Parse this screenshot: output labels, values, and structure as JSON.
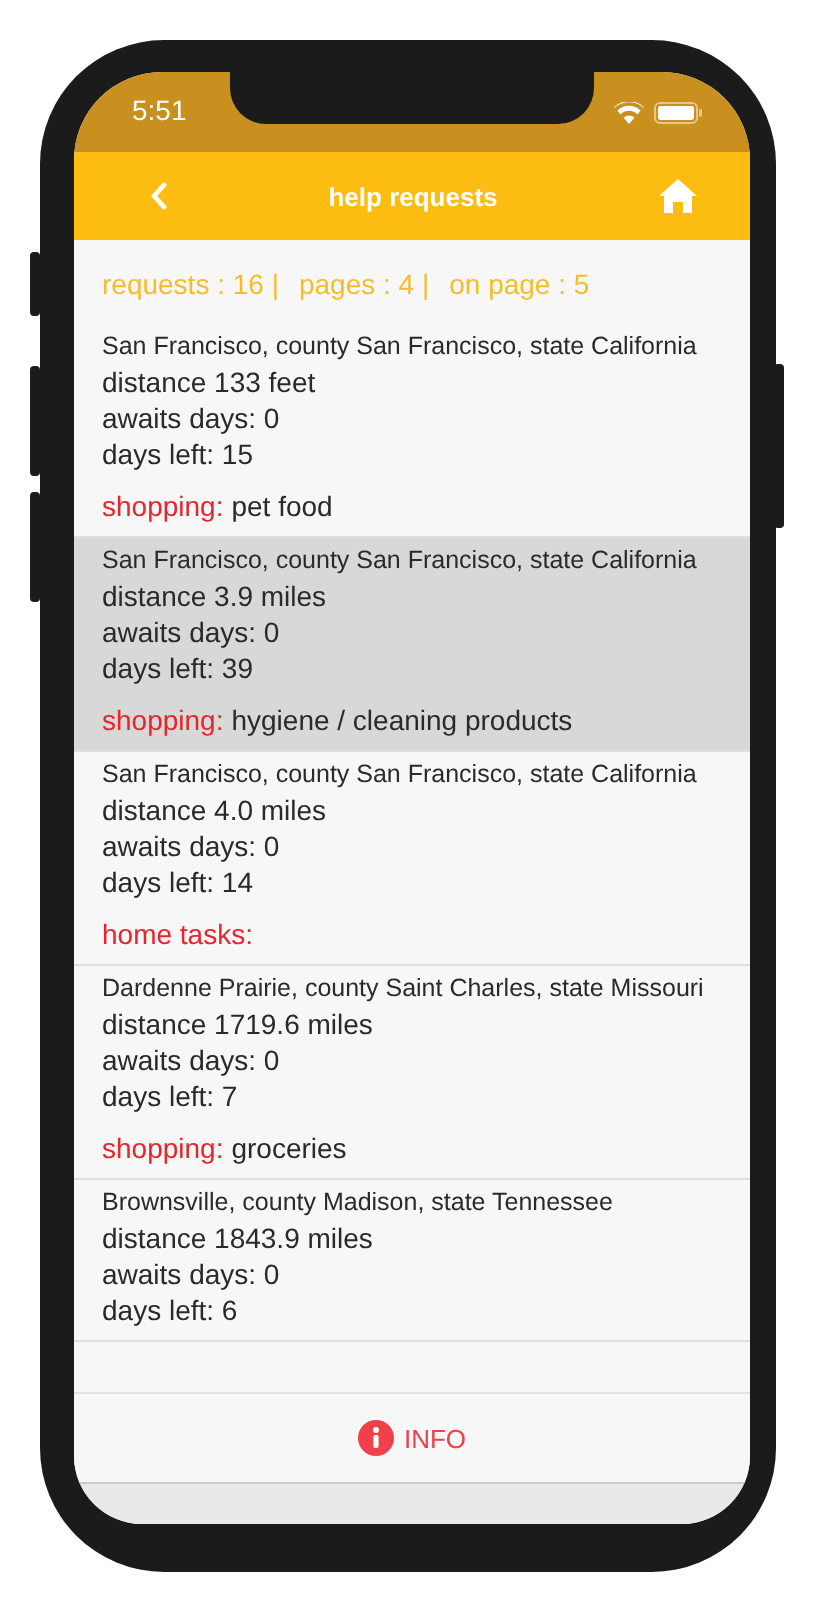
{
  "status_bar": {
    "time": "5:51"
  },
  "nav": {
    "title": "help requests"
  },
  "summary": [
    "requests  : 16 |",
    "pages  : 4 |",
    "on page  : 5"
  ],
  "requests": [
    {
      "address": "San Francisco, county San Francisco, state California",
      "distance": "distance 133 feet",
      "awaits": "awaits days: 0",
      "days_left": "days left: 15",
      "category": "shopping:",
      "detail": "pet food",
      "selected": false
    },
    {
      "address": "San Francisco, county San Francisco, state California",
      "distance": "distance 3.9 miles",
      "awaits": "awaits days: 0",
      "days_left": "days left: 39",
      "category": "shopping:",
      "detail": "hygiene / cleaning products",
      "selected": true
    },
    {
      "address": "San Francisco, county San Francisco, state California",
      "distance": "distance 4.0 miles",
      "awaits": "awaits days: 0",
      "days_left": "days left: 14",
      "category": "home tasks:",
      "selected": false
    },
    {
      "address": "Dardenne Prairie, county Saint Charles, state Missouri",
      "distance": "distance 1719.6 miles",
      "awaits": "awaits days: 0",
      "days_left": "days left: 7",
      "category": "shopping:",
      "detail": "groceries",
      "selected": false
    },
    {
      "address": "Brownsville, county Madison, state Tennessee",
      "distance": "distance 1843.9 miles",
      "awaits": "awaits days: 0",
      "days_left": "days left: 6",
      "selected": false
    }
  ],
  "footer": {
    "button": "INFO"
  }
}
